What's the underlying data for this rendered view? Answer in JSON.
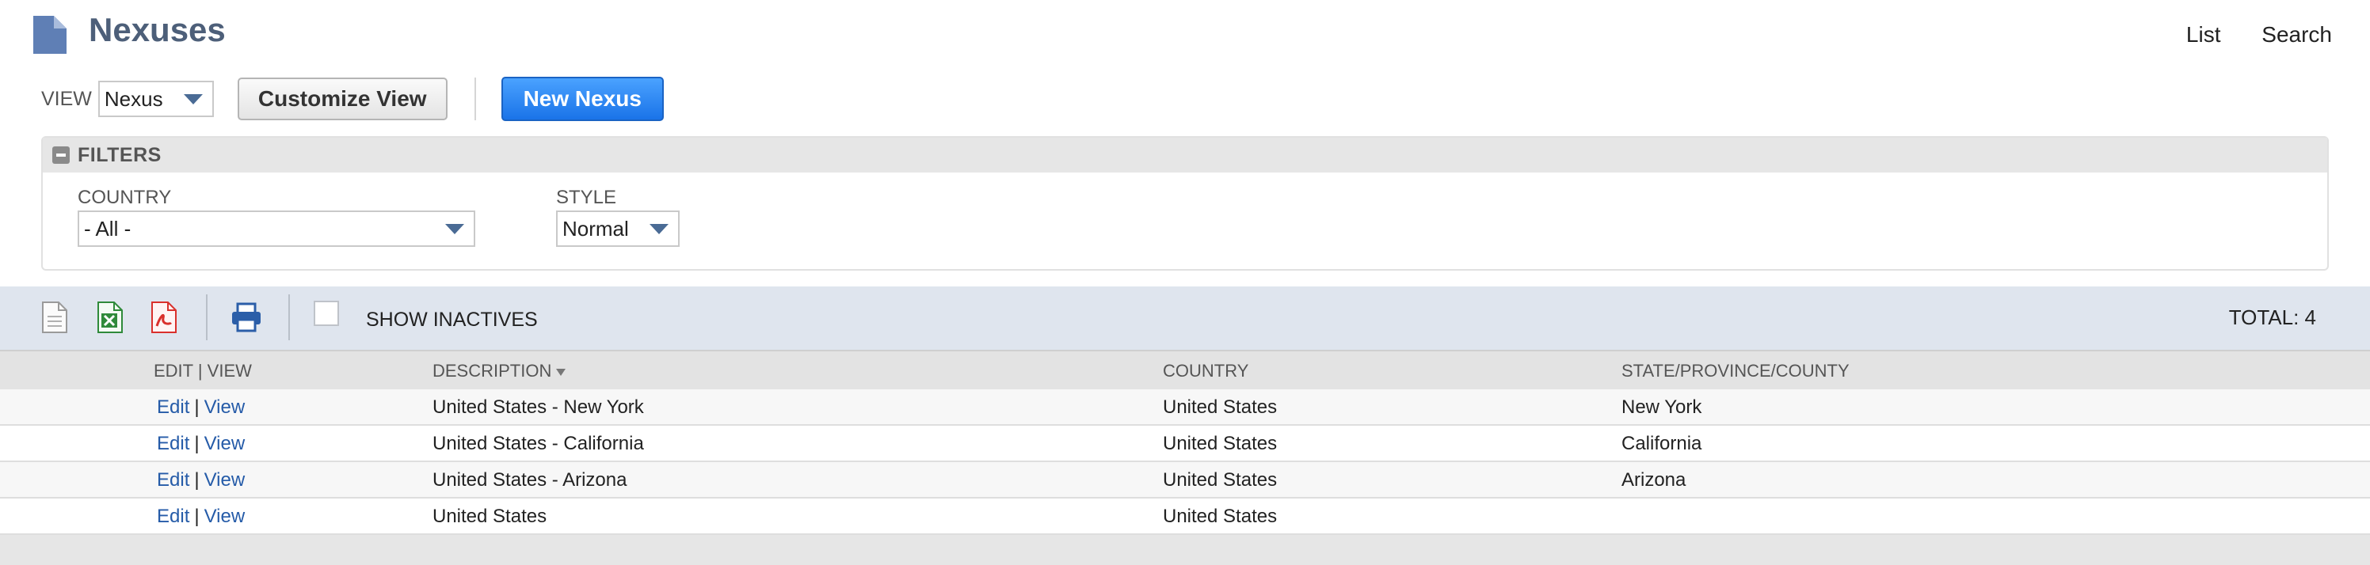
{
  "header": {
    "title": "Nexuses",
    "links": [
      "List",
      "Search"
    ]
  },
  "view": {
    "label": "VIEW",
    "selected": "Nexus",
    "customize_label": "Customize View",
    "new_label": "New Nexus"
  },
  "filters": {
    "title": "FILTERS",
    "country_label": "COUNTRY",
    "country_value": "- All -",
    "style_label": "STYLE",
    "style_value": "Normal"
  },
  "toolbar": {
    "show_inactives_label": "SHOW INACTIVES",
    "total": "TOTAL: 4"
  },
  "table": {
    "columns": {
      "edit_view": "EDIT | VIEW",
      "description": "DESCRIPTION",
      "country": "COUNTRY",
      "state": "STATE/PROVINCE/COUNTY"
    },
    "edit_label": "Edit",
    "view_label": "View",
    "rows": [
      {
        "description": "United States - New York",
        "country": "United States",
        "state": "New York"
      },
      {
        "description": "United States - California",
        "country": "United States",
        "state": "California"
      },
      {
        "description": "United States - Arizona",
        "country": "United States",
        "state": "Arizona"
      },
      {
        "description": "United States",
        "country": "United States",
        "state": ""
      }
    ]
  },
  "colors": {
    "title": "#4d5f79",
    "primary_button": "#1a73e8",
    "link": "#255ba8",
    "toolbar_bg": "#dfe5ee"
  },
  "icons": [
    "document-icon",
    "csv-export-icon",
    "excel-export-icon",
    "pdf-export-icon",
    "print-icon"
  ]
}
